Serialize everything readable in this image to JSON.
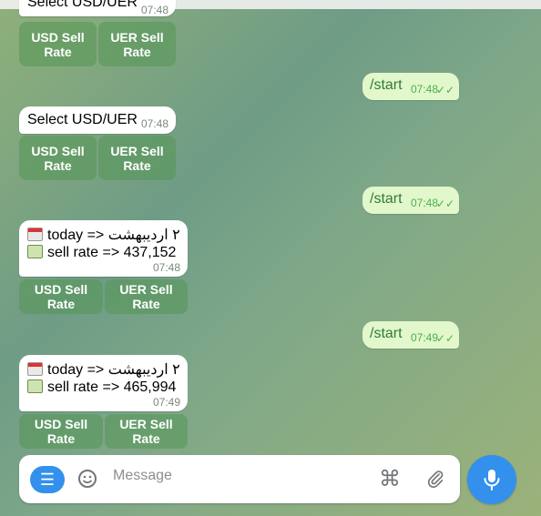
{
  "messages": [
    {
      "text": "Select USD/UER",
      "time": "07:48"
    },
    {
      "text": "Select USD/UER",
      "time": "07:48"
    }
  ],
  "keyboard_1": {
    "usd": "USD Sell Rate",
    "uer": "UER Sell Rate"
  },
  "keyboard_2": {
    "usd": "USD Sell Rate",
    "uer": "UER Sell Rate"
  },
  "keyboard_3": {
    "usd": "USD Sell Rate",
    "uer": "UER Sell Rate"
  },
  "keyboard_4": {
    "usd": "USD Sell Rate",
    "uer": "UER Sell Rate"
  },
  "outgoing": [
    {
      "text": "/start",
      "time": "07:48",
      "ticks": "✓✓"
    },
    {
      "text": "/start",
      "time": "07:48",
      "ticks": "✓✓"
    },
    {
      "text": "/start",
      "time": "07:49",
      "ticks": "✓✓"
    }
  ],
  "rate_messages": [
    {
      "line1_prefix": "today  =>",
      "line1_date": "۲ اردیبهشت",
      "line2": "sell rate => 437,152",
      "time": "07:48"
    },
    {
      "line1_prefix": "today  =>",
      "line1_date": "۲ اردیبهشت",
      "line2": "sell rate => 465,994",
      "time": "07:49"
    }
  ],
  "composer": {
    "placeholder": "Message",
    "command_symbol": "⌘",
    "menu_symbol": "☰"
  },
  "icons": {
    "menu": "menu-icon",
    "emoji": "smiley-icon",
    "commands": "command-icon",
    "attach": "paperclip-icon",
    "mic": "microphone-icon",
    "calendar": "calendar-icon",
    "money": "banknote-icon"
  },
  "colors": {
    "accent": "#3390ec",
    "outgoing_bubble": "#e2f7cb",
    "check": "#4fae4e"
  }
}
